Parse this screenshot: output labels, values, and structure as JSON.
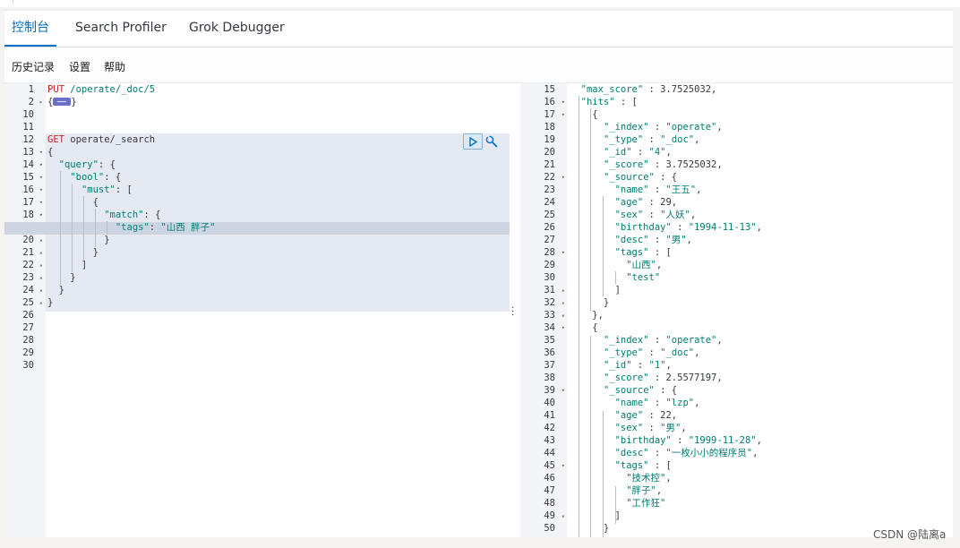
{
  "tabs": [
    "控制台",
    "Search Profiler",
    "Grok Debugger"
  ],
  "menu": [
    "历史记录",
    "设置",
    "帮助"
  ],
  "editor": {
    "lines": [
      {
        "n": "1",
        "fold": "",
        "code": [
          [
            "k",
            "PUT"
          ],
          [
            "s",
            " /operate/_doc/5"
          ]
        ]
      },
      {
        "n": "2",
        "fold": "▸",
        "code": [
          [
            "p",
            "{"
          ],
          [
            "fold",
            ""
          ],
          [
            "p",
            "}"
          ]
        ]
      },
      {
        "n": "10",
        "fold": "",
        "code": []
      },
      {
        "n": "11",
        "fold": "",
        "code": []
      },
      {
        "n": "12",
        "fold": "",
        "code": [
          [
            "k",
            "GET"
          ],
          [
            "p",
            " operate/_search"
          ]
        ]
      },
      {
        "n": "13",
        "fold": "▾",
        "code": [
          [
            "p",
            "{"
          ]
        ]
      },
      {
        "n": "14",
        "fold": "▾",
        "code": [
          [
            "p",
            "  "
          ],
          [
            "s",
            "\"query\""
          ],
          [
            "p",
            ": {"
          ]
        ]
      },
      {
        "n": "15",
        "fold": "▾",
        "code": [
          [
            "p",
            "    "
          ],
          [
            "s",
            "\"bool\""
          ],
          [
            "p",
            ": {"
          ]
        ]
      },
      {
        "n": "16",
        "fold": "▾",
        "code": [
          [
            "p",
            "      "
          ],
          [
            "s",
            "\"must\""
          ],
          [
            "p",
            ": ["
          ]
        ]
      },
      {
        "n": "17",
        "fold": "▾",
        "code": [
          [
            "p",
            "        {"
          ]
        ]
      },
      {
        "n": "18",
        "fold": "▾",
        "code": [
          [
            "p",
            "          "
          ],
          [
            "s",
            "\"match\""
          ],
          [
            "p",
            ": {"
          ]
        ]
      },
      {
        "n": "19",
        "fold": "",
        "code": [
          [
            "p",
            "            "
          ],
          [
            "s",
            "\"tags\""
          ],
          [
            "p",
            ": "
          ],
          [
            "s",
            "\"山西 胖子\""
          ]
        ]
      },
      {
        "n": "20",
        "fold": "▴",
        "code": [
          [
            "p",
            "          }"
          ]
        ]
      },
      {
        "n": "21",
        "fold": "▴",
        "code": [
          [
            "p",
            "        }"
          ]
        ]
      },
      {
        "n": "22",
        "fold": "▴",
        "code": [
          [
            "p",
            "      ]"
          ]
        ]
      },
      {
        "n": "23",
        "fold": "▴",
        "code": [
          [
            "p",
            "    }"
          ]
        ]
      },
      {
        "n": "24",
        "fold": "▴",
        "code": [
          [
            "p",
            "  }"
          ]
        ]
      },
      {
        "n": "25",
        "fold": "▴",
        "code": [
          [
            "p",
            "}"
          ]
        ]
      },
      {
        "n": "26",
        "fold": "",
        "code": []
      },
      {
        "n": "27",
        "fold": "",
        "code": []
      },
      {
        "n": "28",
        "fold": "",
        "code": []
      },
      {
        "n": "29",
        "fold": "",
        "code": []
      },
      {
        "n": "30",
        "fold": "",
        "code": []
      }
    ]
  },
  "output": {
    "lines": [
      {
        "n": "15",
        "fold": "",
        "code": [
          [
            "p",
            "  "
          ],
          [
            "s",
            "\"max_score\""
          ],
          [
            "p",
            " : 3.7525032,"
          ]
        ]
      },
      {
        "n": "16",
        "fold": "▾",
        "code": [
          [
            "p",
            "  "
          ],
          [
            "s",
            "\"hits\""
          ],
          [
            "p",
            " : ["
          ]
        ]
      },
      {
        "n": "17",
        "fold": "▾",
        "code": [
          [
            "p",
            "    {"
          ]
        ]
      },
      {
        "n": "18",
        "fold": "",
        "code": [
          [
            "p",
            "      "
          ],
          [
            "s",
            "\"_index\""
          ],
          [
            "p",
            " : "
          ],
          [
            "s",
            "\"operate\""
          ],
          [
            "p",
            ","
          ]
        ]
      },
      {
        "n": "19",
        "fold": "",
        "code": [
          [
            "p",
            "      "
          ],
          [
            "s",
            "\"_type\""
          ],
          [
            "p",
            " : "
          ],
          [
            "s",
            "\"_doc\""
          ],
          [
            "p",
            ","
          ]
        ]
      },
      {
        "n": "20",
        "fold": "",
        "code": [
          [
            "p",
            "      "
          ],
          [
            "s",
            "\"_id\""
          ],
          [
            "p",
            " : "
          ],
          [
            "s",
            "\"4\""
          ],
          [
            "p",
            ","
          ]
        ]
      },
      {
        "n": "21",
        "fold": "",
        "code": [
          [
            "p",
            "      "
          ],
          [
            "s",
            "\"_score\""
          ],
          [
            "p",
            " : 3.7525032,"
          ]
        ]
      },
      {
        "n": "22",
        "fold": "▾",
        "code": [
          [
            "p",
            "      "
          ],
          [
            "s",
            "\"_source\""
          ],
          [
            "p",
            " : {"
          ]
        ]
      },
      {
        "n": "23",
        "fold": "",
        "code": [
          [
            "p",
            "        "
          ],
          [
            "s",
            "\"name\""
          ],
          [
            "p",
            " : "
          ],
          [
            "s",
            "\"王五\""
          ],
          [
            "p",
            ","
          ]
        ]
      },
      {
        "n": "24",
        "fold": "",
        "code": [
          [
            "p",
            "        "
          ],
          [
            "s",
            "\"age\""
          ],
          [
            "p",
            " : 29,"
          ]
        ]
      },
      {
        "n": "25",
        "fold": "",
        "code": [
          [
            "p",
            "        "
          ],
          [
            "s",
            "\"sex\""
          ],
          [
            "p",
            " : "
          ],
          [
            "s",
            "\"人妖\""
          ],
          [
            "p",
            ","
          ]
        ]
      },
      {
        "n": "26",
        "fold": "",
        "code": [
          [
            "p",
            "        "
          ],
          [
            "s",
            "\"birthday\""
          ],
          [
            "p",
            " : "
          ],
          [
            "s",
            "\"1994-11-13\""
          ],
          [
            "p",
            ","
          ]
        ]
      },
      {
        "n": "27",
        "fold": "",
        "code": [
          [
            "p",
            "        "
          ],
          [
            "s",
            "\"desc\""
          ],
          [
            "p",
            " : "
          ],
          [
            "s",
            "\"男\""
          ],
          [
            "p",
            ","
          ]
        ]
      },
      {
        "n": "28",
        "fold": "▾",
        "code": [
          [
            "p",
            "        "
          ],
          [
            "s",
            "\"tags\""
          ],
          [
            "p",
            " : ["
          ]
        ]
      },
      {
        "n": "29",
        "fold": "",
        "code": [
          [
            "p",
            "          "
          ],
          [
            "s",
            "\"山西\""
          ],
          [
            "p",
            ","
          ]
        ]
      },
      {
        "n": "30",
        "fold": "",
        "code": [
          [
            "p",
            "          "
          ],
          [
            "s",
            "\"test\""
          ]
        ]
      },
      {
        "n": "31",
        "fold": "▴",
        "code": [
          [
            "p",
            "        ]"
          ]
        ]
      },
      {
        "n": "32",
        "fold": "▴",
        "code": [
          [
            "p",
            "      }"
          ]
        ]
      },
      {
        "n": "33",
        "fold": "▴",
        "code": [
          [
            "p",
            "    },"
          ]
        ]
      },
      {
        "n": "34",
        "fold": "▾",
        "code": [
          [
            "p",
            "    {"
          ]
        ]
      },
      {
        "n": "35",
        "fold": "",
        "code": [
          [
            "p",
            "      "
          ],
          [
            "s",
            "\"_index\""
          ],
          [
            "p",
            " : "
          ],
          [
            "s",
            "\"operate\""
          ],
          [
            "p",
            ","
          ]
        ]
      },
      {
        "n": "36",
        "fold": "",
        "code": [
          [
            "p",
            "      "
          ],
          [
            "s",
            "\"_type\""
          ],
          [
            "p",
            " : "
          ],
          [
            "s",
            "\"_doc\""
          ],
          [
            "p",
            ","
          ]
        ]
      },
      {
        "n": "37",
        "fold": "",
        "code": [
          [
            "p",
            "      "
          ],
          [
            "s",
            "\"_id\""
          ],
          [
            "p",
            " : "
          ],
          [
            "s",
            "\"1\""
          ],
          [
            "p",
            ","
          ]
        ]
      },
      {
        "n": "38",
        "fold": "",
        "code": [
          [
            "p",
            "      "
          ],
          [
            "s",
            "\"_score\""
          ],
          [
            "p",
            " : 2.5577197,"
          ]
        ]
      },
      {
        "n": "39",
        "fold": "▾",
        "code": [
          [
            "p",
            "      "
          ],
          [
            "s",
            "\"_source\""
          ],
          [
            "p",
            " : {"
          ]
        ]
      },
      {
        "n": "40",
        "fold": "",
        "code": [
          [
            "p",
            "        "
          ],
          [
            "s",
            "\"name\""
          ],
          [
            "p",
            " : "
          ],
          [
            "s",
            "\"lzp\""
          ],
          [
            "p",
            ","
          ]
        ]
      },
      {
        "n": "41",
        "fold": "",
        "code": [
          [
            "p",
            "        "
          ],
          [
            "s",
            "\"age\""
          ],
          [
            "p",
            " : 22,"
          ]
        ]
      },
      {
        "n": "42",
        "fold": "",
        "code": [
          [
            "p",
            "        "
          ],
          [
            "s",
            "\"sex\""
          ],
          [
            "p",
            " : "
          ],
          [
            "s",
            "\"男\""
          ],
          [
            "p",
            ","
          ]
        ]
      },
      {
        "n": "43",
        "fold": "",
        "code": [
          [
            "p",
            "        "
          ],
          [
            "s",
            "\"birthday\""
          ],
          [
            "p",
            " : "
          ],
          [
            "s",
            "\"1999-11-28\""
          ],
          [
            "p",
            ","
          ]
        ]
      },
      {
        "n": "44",
        "fold": "",
        "code": [
          [
            "p",
            "        "
          ],
          [
            "s",
            "\"desc\""
          ],
          [
            "p",
            " : "
          ],
          [
            "s",
            "\"一枚小小的程序员\""
          ],
          [
            "p",
            ","
          ]
        ]
      },
      {
        "n": "45",
        "fold": "▾",
        "code": [
          [
            "p",
            "        "
          ],
          [
            "s",
            "\"tags\""
          ],
          [
            "p",
            " : ["
          ]
        ]
      },
      {
        "n": "46",
        "fold": "",
        "code": [
          [
            "p",
            "          "
          ],
          [
            "s",
            "\"技术控\""
          ],
          [
            "p",
            ","
          ]
        ]
      },
      {
        "n": "47",
        "fold": "",
        "code": [
          [
            "p",
            "          "
          ],
          [
            "s",
            "\"胖子\""
          ],
          [
            "p",
            ","
          ]
        ]
      },
      {
        "n": "48",
        "fold": "",
        "code": [
          [
            "p",
            "          "
          ],
          [
            "s",
            "\"工作狂\""
          ]
        ]
      },
      {
        "n": "49",
        "fold": "▴",
        "code": [
          [
            "p",
            "        ]"
          ]
        ]
      },
      {
        "n": "50",
        "fold": "",
        "code": [
          [
            "p",
            "      }"
          ]
        ]
      }
    ]
  },
  "watermark": "CSDN @陆离a",
  "colors": {
    "accent": "#0071c2",
    "keyword": "#bd271e",
    "string": "#017d73"
  }
}
